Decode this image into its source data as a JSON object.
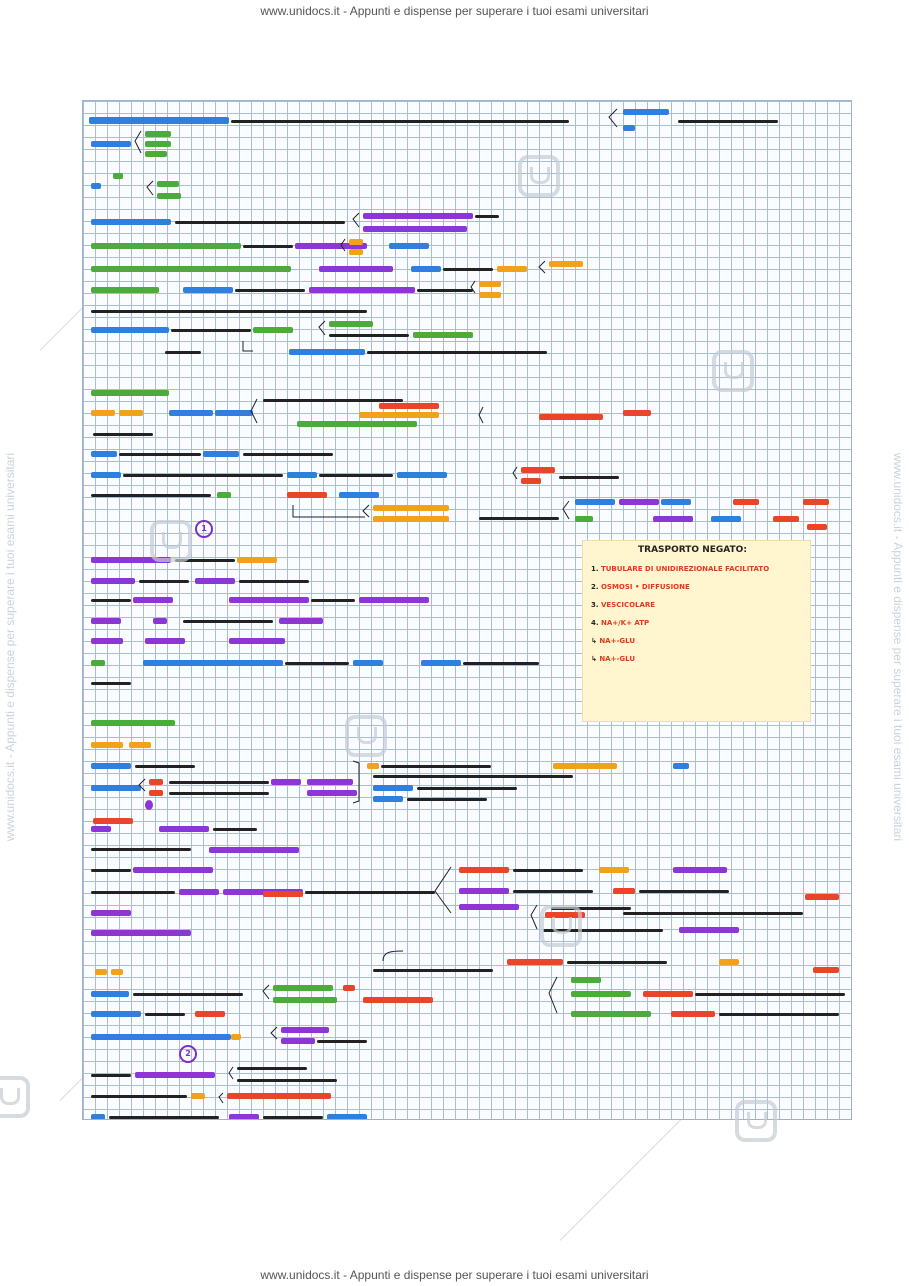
{
  "banner": {
    "top": "www.unidocs.it - Appunti e dispense per superare i tuoi esami universitari",
    "bottom": "www.unidocs.it - Appunti e dispense per superare i tuoi esami universitari",
    "side_left": "www.unidocs.it - Appunti e dispense per superare i tuoi esami universitari",
    "side_right": "www.unidocs.it - Appunti e dispense per superare i tuoi esami universitari"
  },
  "note": {
    "title": "TRASPORTO NEGATO:",
    "items": [
      {
        "num": "1.",
        "text": "TUBULARE DI UNIDIREZIONALE FACILITATO"
      },
      {
        "num": "2.",
        "text": "OSMOSI • DIFFUSIONE"
      },
      {
        "num": "3.",
        "text": "VESCICOLARE"
      },
      {
        "num": "4.",
        "text": "NA+/K+ ATP"
      },
      {
        "num": "↳",
        "text": "NA+-GLU"
      },
      {
        "num": "↳",
        "text": "NA+-GLU"
      }
    ]
  },
  "badges": {
    "b1": "1",
    "b2": "2"
  },
  "colors": {
    "blue": "#1e73d8",
    "green": "#3fa534",
    "orange": "#e8920c",
    "red": "#e23a1e",
    "purple": "#8a2be2",
    "note_bg": "#fff6cf",
    "grid": "#a9bdd6"
  }
}
